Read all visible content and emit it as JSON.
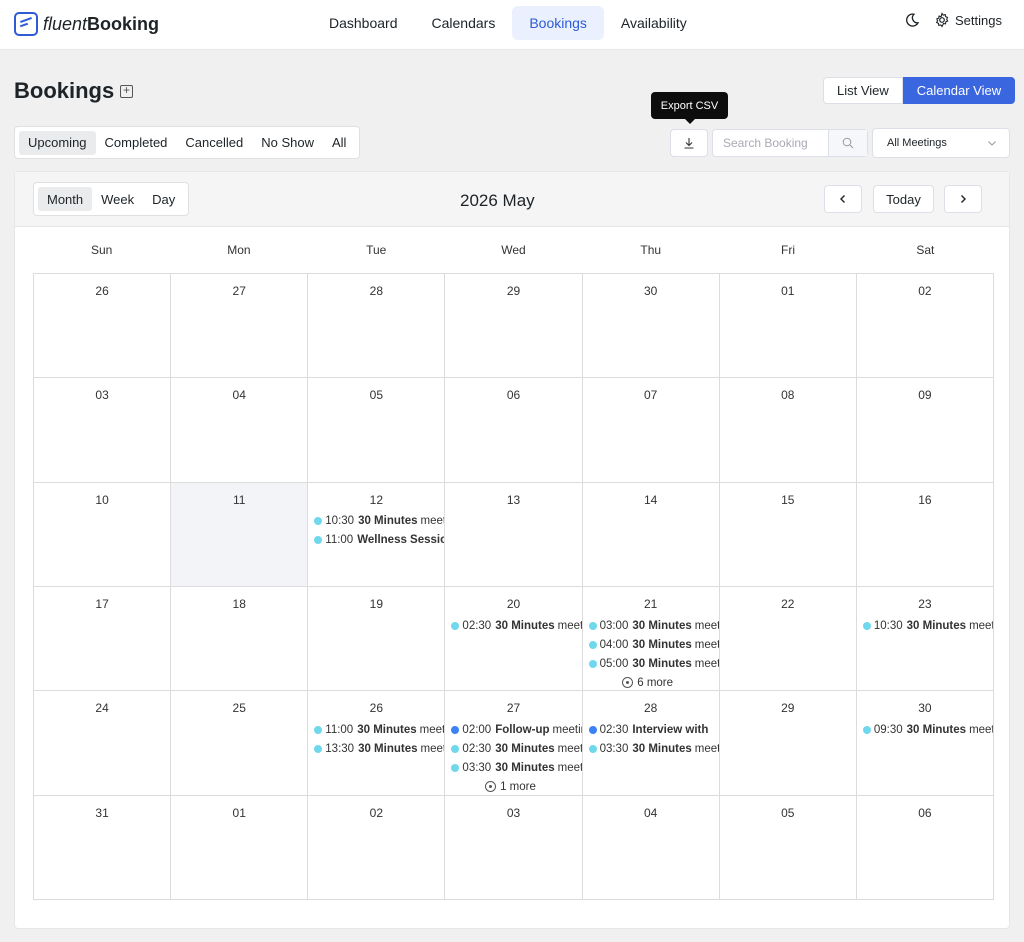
{
  "app": {
    "brand_light": "fluent",
    "brand_bold": "Booking"
  },
  "nav": {
    "items": [
      "Dashboard",
      "Calendars",
      "Bookings",
      "Availability"
    ],
    "active": "Bookings"
  },
  "header_right": {
    "settings_label": "Settings"
  },
  "page": {
    "title": "Bookings"
  },
  "views": {
    "list": "List View",
    "calendar": "Calendar View",
    "active": "Calendar View"
  },
  "filters": {
    "items": [
      "Upcoming",
      "Completed",
      "Cancelled",
      "No Show",
      "All"
    ],
    "active": "Upcoming"
  },
  "toolbar": {
    "export_tooltip": "Export CSV",
    "search_placeholder": "Search Booking",
    "meetings_select": "All Meetings"
  },
  "calendar": {
    "ranges": [
      "Month",
      "Week",
      "Day"
    ],
    "active_range": "Month",
    "title": "2026 May",
    "today_label": "Today",
    "weekdays": [
      "Sun",
      "Mon",
      "Tue",
      "Wed",
      "Thu",
      "Fri",
      "Sat"
    ],
    "today_day": "11",
    "weeks": [
      [
        {
          "day": "26",
          "events": []
        },
        {
          "day": "27",
          "events": []
        },
        {
          "day": "28",
          "events": []
        },
        {
          "day": "29",
          "events": []
        },
        {
          "day": "30",
          "events": []
        },
        {
          "day": "01",
          "events": []
        },
        {
          "day": "02",
          "events": []
        }
      ],
      [
        {
          "day": "03",
          "events": []
        },
        {
          "day": "04",
          "events": []
        },
        {
          "day": "05",
          "events": []
        },
        {
          "day": "06",
          "events": []
        },
        {
          "day": "07",
          "events": []
        },
        {
          "day": "08",
          "events": []
        },
        {
          "day": "09",
          "events": []
        }
      ],
      [
        {
          "day": "10",
          "events": []
        },
        {
          "day": "11",
          "events": []
        },
        {
          "day": "12",
          "events": [
            {
              "time": "10:30",
              "title": "30 Minutes",
              "rest": "meeting",
              "color": "#6fd8ec"
            },
            {
              "time": "11:00",
              "title": "Wellness Session",
              "rest": "",
              "color": "#6fd8ec"
            }
          ]
        },
        {
          "day": "13",
          "events": []
        },
        {
          "day": "14",
          "events": []
        },
        {
          "day": "15",
          "events": []
        },
        {
          "day": "16",
          "events": []
        }
      ],
      [
        {
          "day": "17",
          "events": []
        },
        {
          "day": "18",
          "events": []
        },
        {
          "day": "19",
          "events": []
        },
        {
          "day": "20",
          "events": [
            {
              "time": "02:30",
              "title": "30 Minutes",
              "rest": "meeting",
              "color": "#6fd8ec"
            }
          ]
        },
        {
          "day": "21",
          "events": [
            {
              "time": "03:00",
              "title": "30 Minutes",
              "rest": "meeting",
              "color": "#6fd8ec"
            },
            {
              "time": "04:00",
              "title": "30 Minutes",
              "rest": "meeting",
              "color": "#6fd8ec"
            },
            {
              "time": "05:00",
              "title": "30 Minutes",
              "rest": "meeting",
              "color": "#6fd8ec"
            }
          ],
          "more": "6 more"
        },
        {
          "day": "22",
          "events": []
        },
        {
          "day": "23",
          "events": [
            {
              "time": "10:30",
              "title": "30 Minutes",
              "rest": "meeting",
              "color": "#6fd8ec"
            }
          ]
        }
      ],
      [
        {
          "day": "24",
          "events": []
        },
        {
          "day": "25",
          "events": []
        },
        {
          "day": "26",
          "events": [
            {
              "time": "11:00",
              "title": "30 Minutes",
              "rest": "meeting",
              "color": "#6fd8ec"
            },
            {
              "time": "13:30",
              "title": "30 Minutes",
              "rest": "meeting",
              "color": "#6fd8ec"
            }
          ]
        },
        {
          "day": "27",
          "events": [
            {
              "time": "02:00",
              "title": "Follow-up",
              "rest": "meeting",
              "color": "#3b82f6"
            },
            {
              "time": "02:30",
              "title": "30 Minutes",
              "rest": "meeting",
              "color": "#6fd8ec"
            },
            {
              "time": "03:30",
              "title": "30 Minutes",
              "rest": "meeting",
              "color": "#6fd8ec"
            }
          ],
          "more": "1 more"
        },
        {
          "day": "28",
          "events": [
            {
              "time": "02:30",
              "title": "Interview with",
              "rest": "",
              "color": "#3b82f6"
            },
            {
              "time": "03:30",
              "title": "30 Minutes",
              "rest": "meeting",
              "color": "#6fd8ec"
            }
          ]
        },
        {
          "day": "29",
          "events": []
        },
        {
          "day": "30",
          "events": [
            {
              "time": "09:30",
              "title": "30 Minutes",
              "rest": "meeting",
              "color": "#6fd8ec"
            }
          ]
        }
      ],
      [
        {
          "day": "31",
          "events": []
        },
        {
          "day": "01",
          "events": []
        },
        {
          "day": "02",
          "events": []
        },
        {
          "day": "03",
          "events": []
        },
        {
          "day": "04",
          "events": []
        },
        {
          "day": "05",
          "events": []
        },
        {
          "day": "06",
          "events": []
        }
      ]
    ]
  }
}
